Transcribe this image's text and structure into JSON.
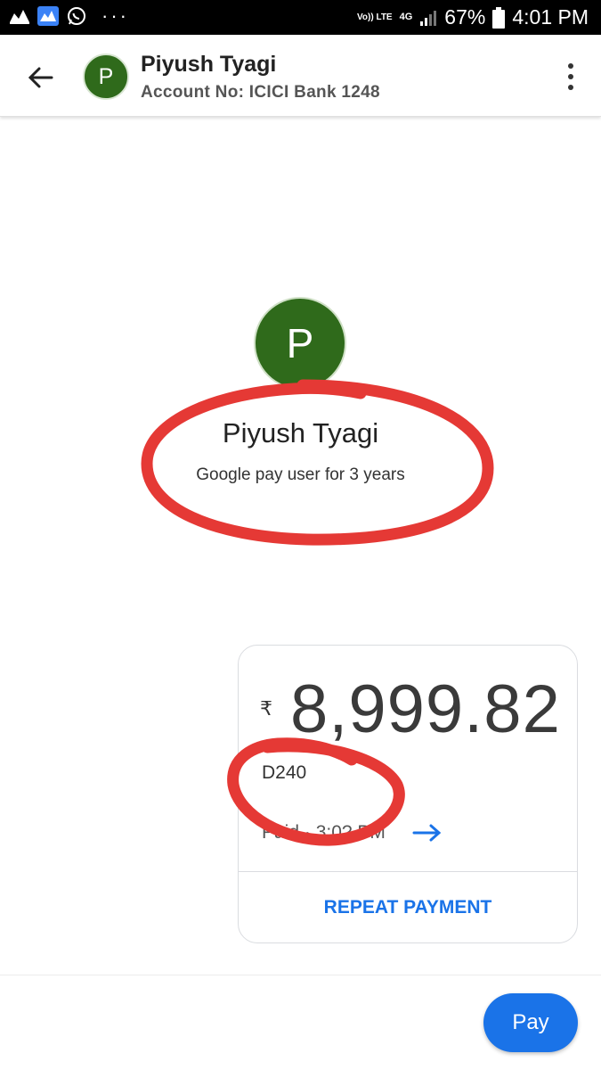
{
  "status_bar": {
    "network_volte": "Vo)) LTE",
    "network_4g": "4G",
    "battery": "67%",
    "time": "4:01 PM",
    "left_icons": [
      "zerodha-icon",
      "zerodha-blue-icon",
      "whatsapp-icon"
    ],
    "more": "···"
  },
  "header": {
    "avatar_letter": "P",
    "name": "Piyush Tyagi",
    "account": "Account No: ICICI Bank 1248"
  },
  "profile": {
    "avatar_letter": "P",
    "name": "Piyush Tyagi",
    "subtitle": "Google pay user for 3 years"
  },
  "payment": {
    "currency_symbol": "₹",
    "amount": "8,999.82",
    "reference": "D240",
    "status": "Paid · 3:0? PM",
    "repeat_label": "REPEAT PAYMENT"
  },
  "footer": {
    "pay_label": "Pay"
  },
  "colors": {
    "accent": "#1a73e8",
    "avatar": "#2f6a1b",
    "annotation": "#e53935"
  }
}
